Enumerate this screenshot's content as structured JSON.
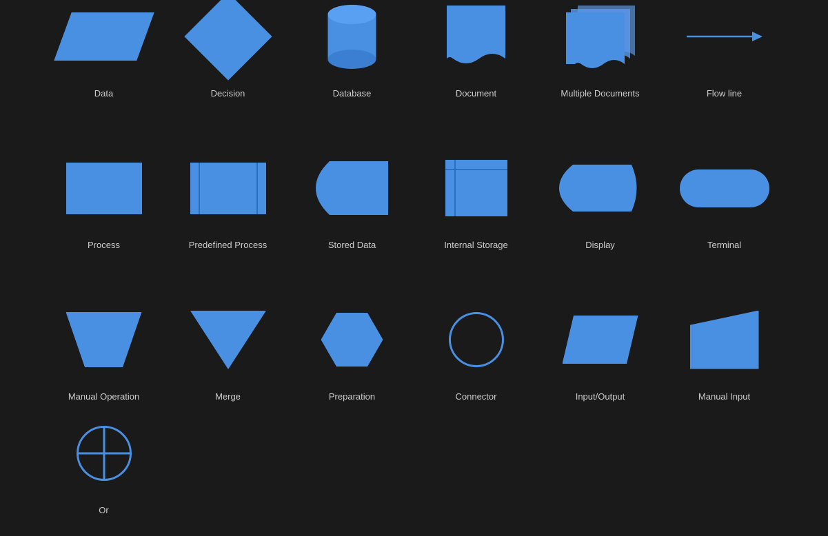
{
  "shapes": {
    "row1": [
      {
        "id": "data",
        "label": "Data"
      },
      {
        "id": "decision",
        "label": "Decision"
      },
      {
        "id": "database",
        "label": "Database"
      },
      {
        "id": "document",
        "label": "Document"
      },
      {
        "id": "multiple-documents",
        "label": "Multiple Documents"
      },
      {
        "id": "flow-line",
        "label": "Flow line"
      }
    ],
    "row2": [
      {
        "id": "process",
        "label": "Process"
      },
      {
        "id": "predefined-process",
        "label": "Predefined Process"
      },
      {
        "id": "stored-data",
        "label": "Stored Data"
      },
      {
        "id": "internal-storage",
        "label": "Internal Storage"
      },
      {
        "id": "display",
        "label": "Display"
      },
      {
        "id": "terminal",
        "label": "Terminal"
      }
    ],
    "row3": [
      {
        "id": "manual-operation",
        "label": "Manual Operation"
      },
      {
        "id": "merge",
        "label": "Merge"
      },
      {
        "id": "preparation",
        "label": "Preparation"
      },
      {
        "id": "connector",
        "label": "Connector"
      },
      {
        "id": "input-output",
        "label": "Input/Output"
      },
      {
        "id": "manual-input",
        "label": "Manual Input"
      },
      {
        "id": "or",
        "label": "Or"
      }
    ]
  },
  "colors": {
    "shape_fill": "#4a90e2",
    "shape_fill_light": "#6aaaf8",
    "shape_fill_dark": "#2a6fc2",
    "background": "#1a1a1a",
    "label": "#cccccc"
  }
}
